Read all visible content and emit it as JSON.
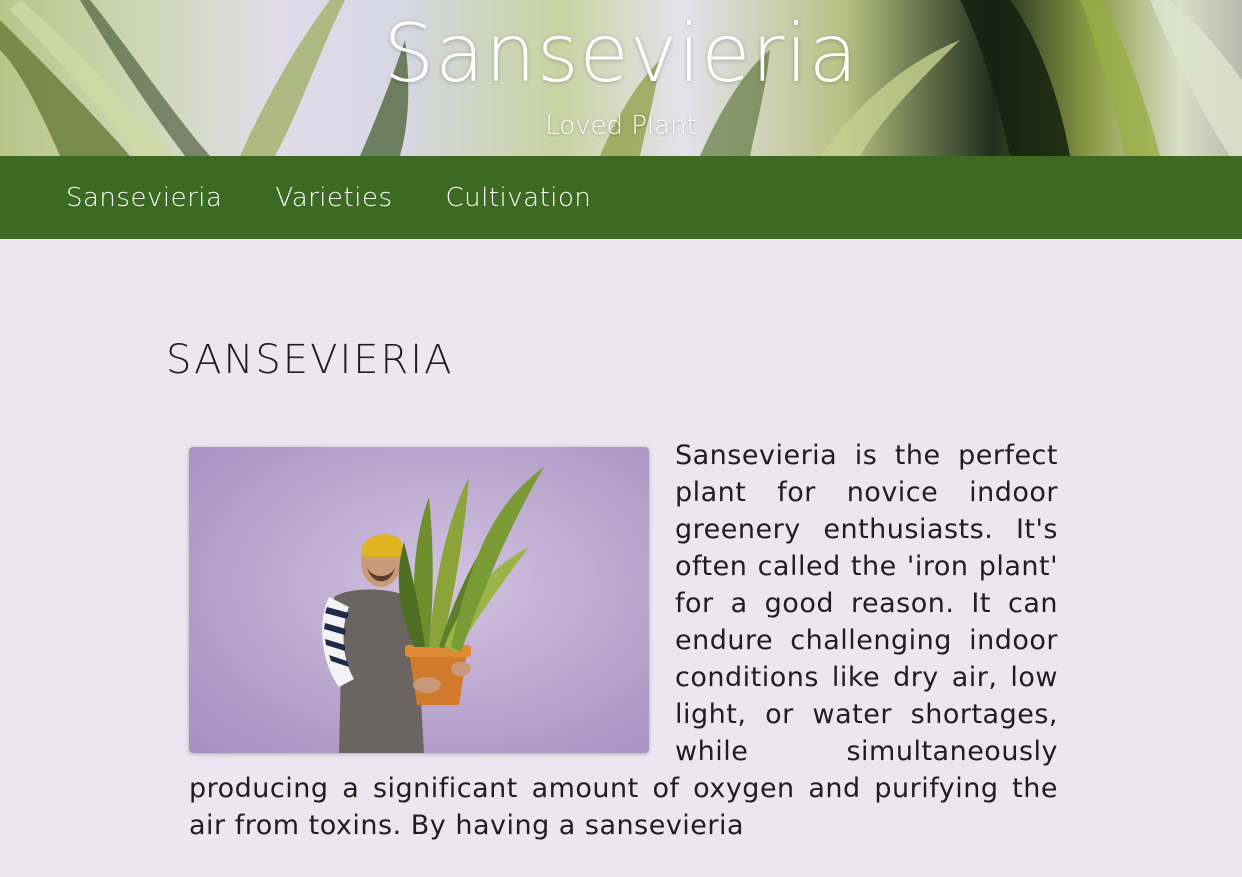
{
  "header": {
    "title": "Sansevieria",
    "subtitle": "Loved Plant"
  },
  "nav": {
    "items": [
      {
        "label": "Sansevieria"
      },
      {
        "label": "Varieties"
      },
      {
        "label": "Cultivation"
      }
    ]
  },
  "main": {
    "heading": "SANSEVIERIA",
    "paragraph": "Sansevieria is the perfect plant for novice indoor greenery enthusiasts. It's often called the 'iron plant' for a good reason. It can endure challenging indoor conditions like dry air, low light, or water shortages, while simultaneously producing a significant amount of oxygen and purifying the air from toxins. By having a sansevieria"
  },
  "colors": {
    "nav_background": "#3c6a23",
    "page_background": "#ebe6ef",
    "photo_background": "#b6a2cc"
  },
  "icons": {
    "photo": "man-holding-snake-plant-photo"
  }
}
